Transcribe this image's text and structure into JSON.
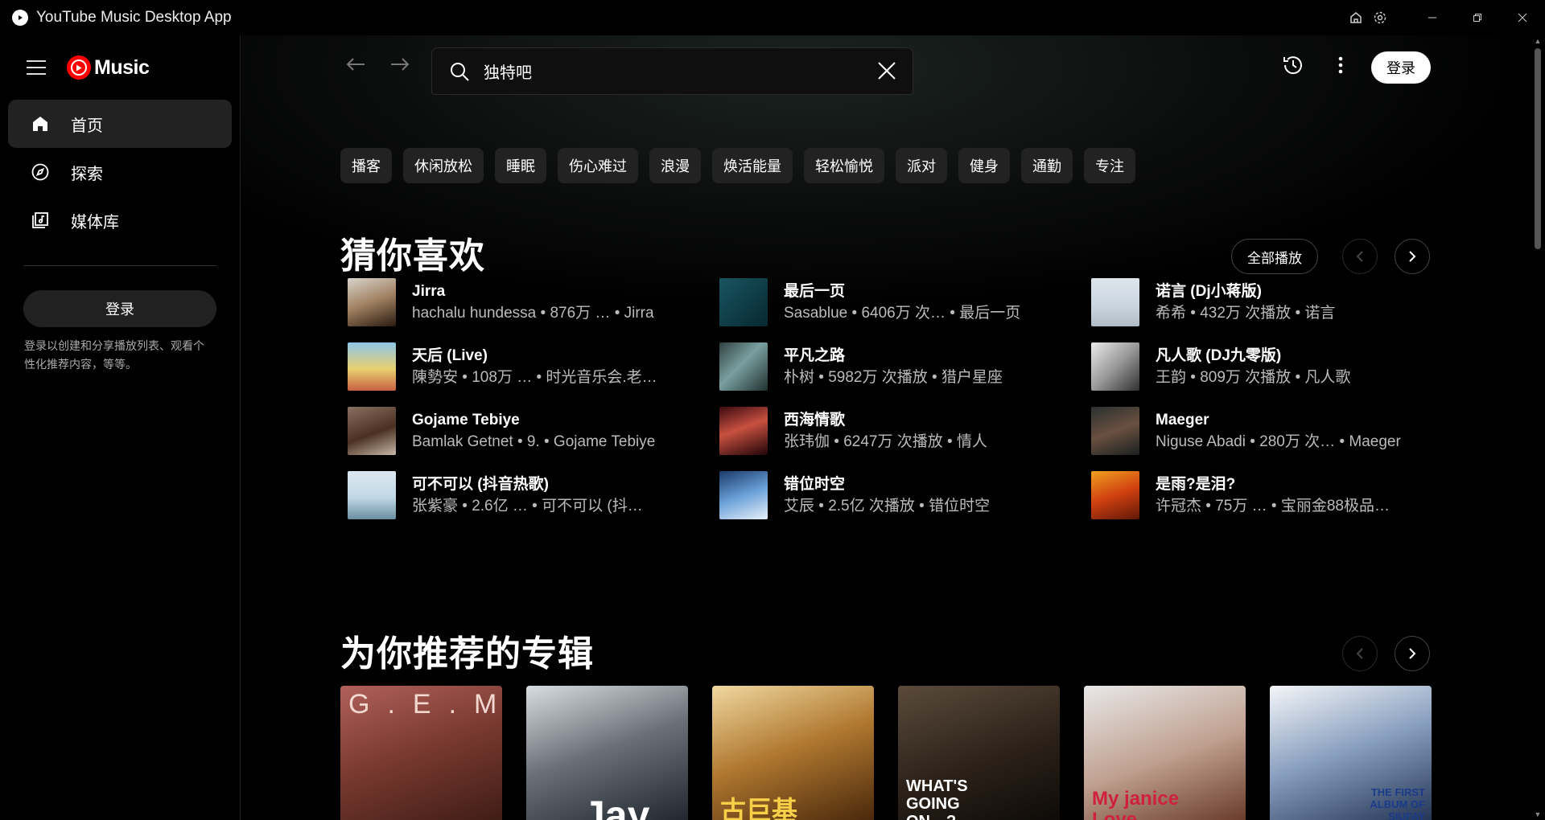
{
  "window": {
    "title": "YouTube Music Desktop App"
  },
  "sidebar": {
    "logo_text": "Music",
    "items": [
      {
        "label": "首页",
        "icon": "home-icon",
        "active": true
      },
      {
        "label": "探索",
        "icon": "compass-icon",
        "active": false
      },
      {
        "label": "媒体库",
        "icon": "library-icon",
        "active": false
      }
    ],
    "login_label": "登录",
    "login_note_line1": "登录以创建和分享播放列表、观看个",
    "login_note_line2": "性化推荐内容，等等。"
  },
  "search": {
    "value": "独特吧"
  },
  "header": {
    "login_label": "登录"
  },
  "chips": [
    "播客",
    "休闲放松",
    "睡眠",
    "伤心难过",
    "浪漫",
    "焕活能量",
    "轻松愉悦",
    "派对",
    "健身",
    "通勤",
    "专注"
  ],
  "section1": {
    "title": "猜你喜欢",
    "play_all": "全部播放",
    "songs": [
      {
        "title": "Jirra",
        "sub": "hachalu hundessa • 876万 … • Jirra"
      },
      {
        "title": "最后一页",
        "sub": "Sasablue • 6406万 次… • 最后一页"
      },
      {
        "title": "诺言 (Dj小蒋版)",
        "sub": "希希 • 432万 次播放 • 诺言"
      },
      {
        "title": "天后 (Live)",
        "sub": "陳勢安 • 108万 … • 时光音乐会.老…"
      },
      {
        "title": "平凡之路",
        "sub": "朴树 • 5982万 次播放 • 猎户星座"
      },
      {
        "title": "凡人歌 (DJ九零版)",
        "sub": "王韵 • 809万 次播放 • 凡人歌"
      },
      {
        "title": "Gojame Tebiye",
        "sub": "Bamlak Getnet • 9. • Gojame Tebiye"
      },
      {
        "title": "西海情歌",
        "sub": "张玮伽 • 6247万 次播放 • 情人"
      },
      {
        "title": "Maeger",
        "sub": "Niguse Abadi • 280万 次… • Maeger"
      },
      {
        "title": "可不可以 (抖音热歌)",
        "sub": "张紫豪 • 2.6亿 … • 可不可以 (抖…"
      },
      {
        "title": "错位时空",
        "sub": "艾辰 • 2.5亿 次播放 • 错位时空"
      },
      {
        "title": "是雨?是泪?",
        "sub": "许冠杰 • 75万 … • 宝丽金88极品…"
      }
    ]
  },
  "section2": {
    "title": "为你推荐的专辑",
    "albums": [
      {
        "text": "G.E.M."
      },
      {
        "text": "Jay"
      },
      {
        "text": "古巨基"
      },
      {
        "text": "WHAT'S GOING ON…?"
      },
      {
        "text": "My janice Love"
      },
      {
        "text": "THE FIRST ALBUM OF SIUFAY"
      }
    ]
  },
  "colors": {
    "accent": "#ff0000",
    "chip_bg": "#222222",
    "background": "#000000"
  }
}
